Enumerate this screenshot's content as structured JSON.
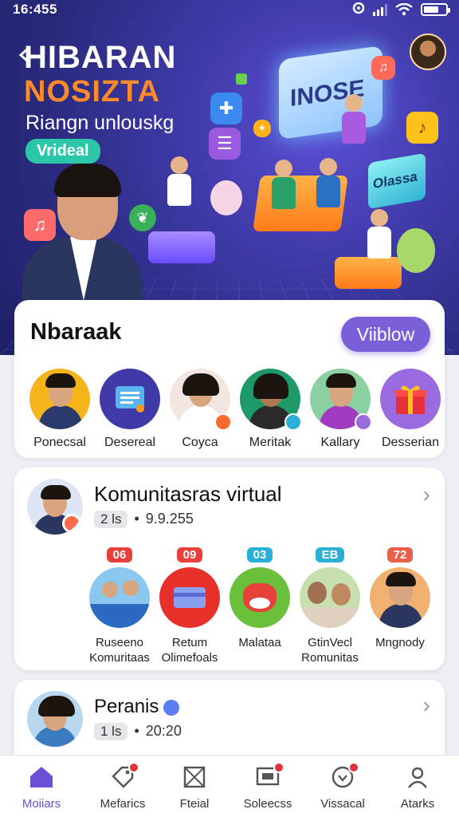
{
  "status_bar": {
    "time": "16:455"
  },
  "hero": {
    "title_line1": "HIBARAN",
    "title_line2": "NOSIZTA",
    "subtitle": "Riangn unlouskg",
    "badge": "Vrideal",
    "screen_text": "INOSE",
    "screen_small_text": "Olassa"
  },
  "stories_card": {
    "title": "Nbaraak",
    "view_button": "Viiblow",
    "items": [
      {
        "name": "Ponecsal",
        "color": "#f4b41a",
        "icon": "person"
      },
      {
        "name": "Desereal",
        "color": "#3f3aa8",
        "icon": "document-icon"
      },
      {
        "name": "Coyca",
        "color": "#f2e6e0",
        "icon": "person"
      },
      {
        "name": "Meritak",
        "color": "#1e9a6a",
        "icon": "person"
      },
      {
        "name": "Kallary",
        "color": "#8ad0a0",
        "icon": "person"
      },
      {
        "name": "Desserian",
        "color": "#9a6ae0",
        "icon": "gift-icon"
      }
    ]
  },
  "community_card": {
    "title": "Komunitasras virtual",
    "pill": "2 ls",
    "count": "9.9.255",
    "items": [
      {
        "badge": "06",
        "badge_color": "#e8403a",
        "line1": "Ruseeno",
        "line2": "Komuritaas",
        "color": "#8ac8f0"
      },
      {
        "badge": "09",
        "badge_color": "#e8403a",
        "line1": "Retum",
        "line2": "Olimefoals",
        "color": "#e8302a"
      },
      {
        "badge": "03",
        "badge_color": "#2ab0d8",
        "line1": "Malataa",
        "line2": "",
        "color": "#6ac03a"
      },
      {
        "badge": "ΕΒ",
        "badge_color": "#2ab0d8",
        "line1": "GtinVecl",
        "line2": "Romunitas",
        "color": "#c8e0b0"
      },
      {
        "badge": "72",
        "badge_color": "#e8604a",
        "line1": "Mngnody",
        "line2": "",
        "color": "#f0b070"
      }
    ]
  },
  "profile_card": {
    "title": "Peranis",
    "pill": "1 ls",
    "time": "20:20"
  },
  "bottom_nav": [
    {
      "label": "Moiiars",
      "active": true,
      "icon": "home-icon",
      "badge": false
    },
    {
      "label": "Mefarics",
      "active": false,
      "icon": "tag-icon",
      "badge": true
    },
    {
      "label": "Fteial",
      "active": false,
      "icon": "grid-icon",
      "badge": false
    },
    {
      "label": "Soleecss",
      "active": false,
      "icon": "screen-icon",
      "badge": true
    },
    {
      "label": "Vissacal",
      "active": false,
      "icon": "chat-icon",
      "badge": true
    },
    {
      "label": "Atarks",
      "active": false,
      "icon": "profile-icon",
      "badge": false
    }
  ]
}
